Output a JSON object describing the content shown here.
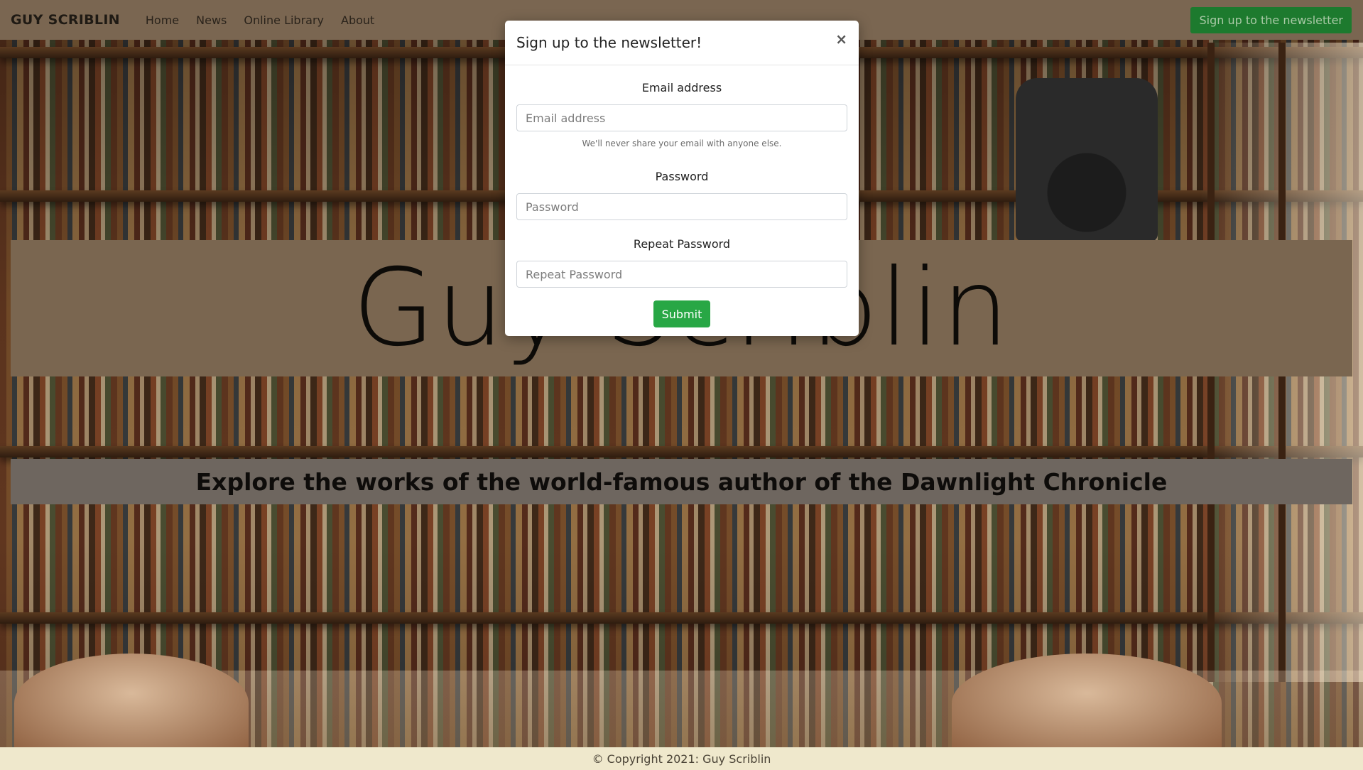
{
  "navbar": {
    "brand": "GUY SCRIBLIN",
    "links": [
      "Home",
      "News",
      "Online Library",
      "About"
    ],
    "cta_label": "Sign up to the newsletter"
  },
  "hero": {
    "title": "Guy Scriblin",
    "tagline": "Explore the works of the world-famous author of the Dawnlight Chronicle"
  },
  "footer": {
    "copyright": "© Copyright 2021: Guy Scriblin"
  },
  "modal": {
    "title": "Sign up to the newsletter!",
    "close_glyph": "×",
    "email": {
      "label": "Email address",
      "placeholder": "Email address",
      "value": "",
      "help": "We'll never share your email with anyone else."
    },
    "password": {
      "label": "Password",
      "placeholder": "Password",
      "value": ""
    },
    "repeat_password": {
      "label": "Repeat Password",
      "placeholder": "Repeat Password",
      "value": ""
    },
    "submit_label": "Submit"
  },
  "colors": {
    "navbar_bg": "#7a6651",
    "cta_bg": "#1d7a2e",
    "submit_bg": "#28a745",
    "hero_band_bg": "#7a6650",
    "tagline_band_bg": "#6e665f",
    "footer_bg": "#efe8cc"
  }
}
